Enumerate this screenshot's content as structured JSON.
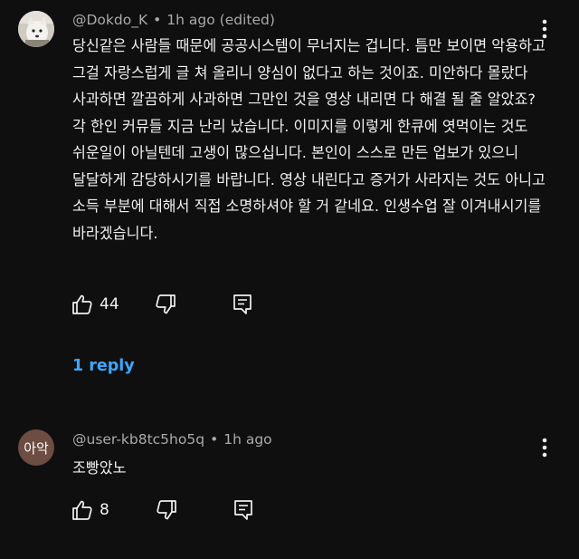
{
  "comments": [
    {
      "author": "@Dokdo_K",
      "separator": "•",
      "time": "1h ago (edited)",
      "avatar_icon": "dog-photo-avatar",
      "text": "당신같은 사람들 때문에 공공시스템이 무너지는 겁니다. 틈만 보이면 악용하고 그걸 자랑스럽게 글 쳐 올리니 양심이 없다고 하는 것이죠. 미안하다 몰랐다 사과하면 깔끔하게 사과하면 그만인 것을 영상 내리면 다 해결 될 줄 알았죠? 각 한인 커뮤들 지금 난리 났습니다. 이미지를 이렇게 한큐에 엿먹이는 것도 쉬운일이 아닐텐데 고생이 많으십니다. 본인이 스스로 만든 업보가 있으니 달달하게 감당하시기를 바랍니다. 영상 내린다고 증거가 사라지는 것도 아니고 소득 부분에 대해서 직접 소명하셔야 할 거 같네요. 인생수업 잘 이겨내시기를 바라겠습니다.",
      "likes": "44",
      "reply_label": "1 reply"
    },
    {
      "author": "@user-kb8tc5ho5q",
      "separator": "•",
      "time": "1h ago",
      "avatar_text": "아악",
      "avatar_color": "#6d4c41",
      "text": "조빵았노",
      "likes": "8"
    }
  ],
  "icons": {
    "like": "thumbs-up-icon",
    "dislike": "thumbs-down-icon",
    "reply": "comment-icon",
    "menu": "more-vert-icon"
  },
  "colors": {
    "background": "#0f0f0f",
    "text": "#f1f1f1",
    "meta": "#aaaaaa",
    "link": "#3ea6ff"
  }
}
